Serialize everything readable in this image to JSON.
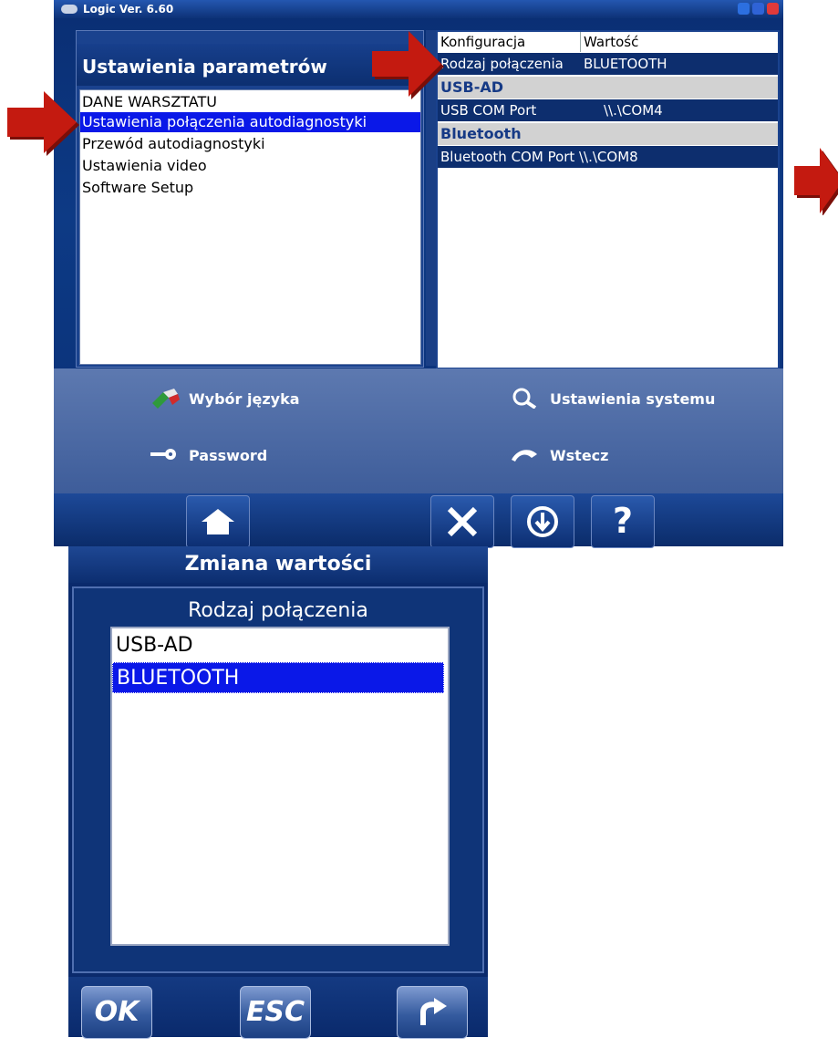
{
  "window": {
    "title": "Logic Ver. 6.60"
  },
  "left_panel": {
    "header": "Ustawienia parametrów",
    "items": [
      {
        "label": "DANE WARSZTATU"
      },
      {
        "label": "Ustawienia połączenia autodiagnostyki",
        "selected": true
      },
      {
        "label": "Przewód autodiagnostyki"
      },
      {
        "label": "Ustawienia video"
      },
      {
        "label": "Software Setup"
      }
    ]
  },
  "right_panel": {
    "col_config": "Konfiguracja",
    "col_value": "Wartość",
    "row1_name": "Rodzaj połączenia",
    "row1_value": "BLUETOOTH",
    "group1": "USB-AD",
    "row2_name": "USB COM Port",
    "row2_value": "\\\\.\\COM4",
    "group2": "Bluetooth",
    "row3_name": "Bluetooth COM Port",
    "row3_value": "\\\\.\\COM8"
  },
  "menu": {
    "language": "Wybór języka",
    "system_settings": "Ustawienia systemu",
    "password": "Password",
    "back": "Wstecz"
  },
  "toolbar": {
    "help": "?"
  },
  "dialog": {
    "title": "Zmiana wartości",
    "label": "Rodzaj połączenia",
    "options": [
      {
        "label": "USB-AD"
      },
      {
        "label": "BLUETOOTH",
        "selected": true
      }
    ],
    "ok": "OK",
    "esc": "ESC"
  },
  "colors": {
    "window_bg": "#0a2e73",
    "selection": "#0a18e8",
    "arrow": "#c41a10"
  }
}
